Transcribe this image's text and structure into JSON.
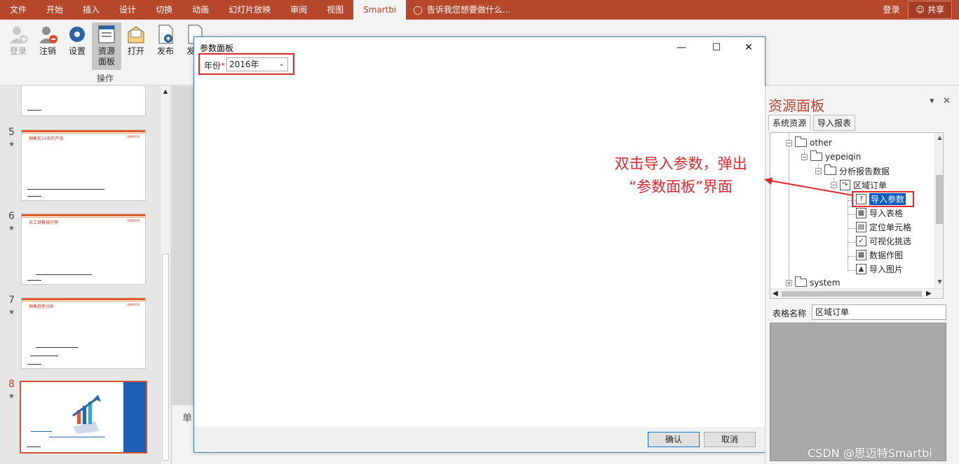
{
  "menubar": {
    "tabs": [
      "文件",
      "开始",
      "插入",
      "设计",
      "切换",
      "动画",
      "幻灯片放映",
      "审阅",
      "视图",
      "Smartbi"
    ],
    "active_tab": "Smartbi",
    "tell_me": "告诉我您想要做什么...",
    "login": "登录",
    "share": "共享"
  },
  "ribbon": {
    "buttons": [
      {
        "label1": "登录",
        "label2": ""
      },
      {
        "label1": "注销",
        "label2": ""
      },
      {
        "label1": "设置",
        "label2": ""
      },
      {
        "label1": "资源",
        "label2": "面板"
      },
      {
        "label1": "打开",
        "label2": ""
      },
      {
        "label1": "发布",
        "label2": ""
      },
      {
        "label1": "发布",
        "label2": ""
      }
    ],
    "group_label": "操作"
  },
  "slides": [
    {
      "num": "5",
      "title": "销售前10名的产品"
    },
    {
      "num": "6",
      "title": "员工销售排行榜"
    },
    {
      "num": "7",
      "title": "销售趋势分析"
    },
    {
      "num": "8",
      "title": ""
    }
  ],
  "editor": {
    "notes_label": "单"
  },
  "dialog": {
    "title": "参数面板",
    "param_label": "年份",
    "required_mark": "*",
    "param_value": "2016年",
    "ok": "确认",
    "cancel": "取消"
  },
  "resource_panel": {
    "title": "资源面板",
    "tabs": [
      "系统资源",
      "导入报表"
    ],
    "tree": {
      "other": "other",
      "yepeiqin": "yepeiqin",
      "folder": "分析报告数据",
      "report": "区域订单",
      "items": [
        "导入参数",
        "导入表格",
        "定位单元格",
        "可视化挑选",
        "数据作图",
        "导入图片"
      ],
      "system": "system"
    },
    "table_name_label": "表格名称",
    "table_name_value": "区域订单"
  },
  "annotation": {
    "line1": "双击导入参数，弹出",
    "line2": "“参数面板”界面"
  },
  "watermark": "CSDN @思迈特Smartbi",
  "colors": {
    "brand": "#b7472a",
    "annotation": "#e0282c"
  }
}
